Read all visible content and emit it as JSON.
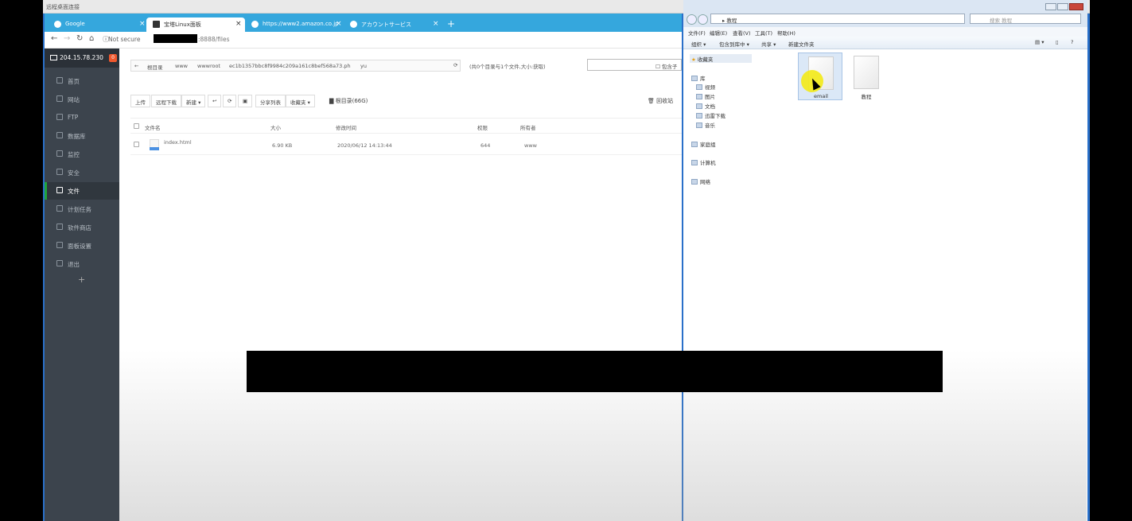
{
  "remote_window": {
    "title": "远程桌面连接"
  },
  "browser": {
    "tabs": [
      {
        "label": "Google",
        "icon": "google-icon"
      },
      {
        "label": "宝塔Linux面板",
        "icon": "bt-icon"
      },
      {
        "label": "https://www2.amazon.co.jp",
        "icon": "globe-icon"
      },
      {
        "label": "アカウントサービス",
        "icon": "amazon-icon"
      }
    ],
    "new_tab": "+",
    "address": {
      "security": "Not secure",
      "rest": ":8888/files"
    }
  },
  "panel": {
    "server_ip": "204.15.78.230",
    "badge": "0",
    "sidebar": [
      {
        "label": "首页"
      },
      {
        "label": "网站"
      },
      {
        "label": "FTP"
      },
      {
        "label": "数据库"
      },
      {
        "label": "监控"
      },
      {
        "label": "安全"
      },
      {
        "label": "文件"
      },
      {
        "label": "计划任务"
      },
      {
        "label": "软件商店"
      },
      {
        "label": "面板设置"
      },
      {
        "label": "退出"
      }
    ],
    "add": "+",
    "breadcrumb": [
      "根目录",
      "www",
      "wwwroot",
      "ec1b1357bbc8f9984c209a161c8bef568a73.ph",
      "yu"
    ],
    "path_info": "(共0个目录与1个文件,大小:获取)",
    "search_checkbox": "包含子",
    "toolbar": [
      "上传",
      "远程下载",
      "新建 ▾",
      "↩",
      "⟳",
      "▣",
      "分享列表",
      "收藏夹 ▾"
    ],
    "root_dir": "根目录(66G)",
    "recycle": "回收站",
    "columns": [
      "文件名",
      "大小",
      "修改时间",
      "权限",
      "所有者"
    ],
    "files": [
      {
        "name": "index.html",
        "size": "6.90 KB",
        "mtime": "2020/06/12 14:13:44",
        "perm": "644",
        "owner": "www"
      }
    ]
  },
  "explorer": {
    "address": "教程",
    "search_placeholder": "搜索 教程",
    "menu": [
      "文件(F)",
      "编辑(E)",
      "查看(V)",
      "工具(T)",
      "帮助(H)"
    ],
    "toolbar": [
      "组织 ▾",
      "包含到库中 ▾",
      "共享 ▾",
      "新建文件夹"
    ],
    "nav": {
      "favorites": "收藏夹",
      "libraries": "库",
      "library_items": [
        "视频",
        "图片",
        "文档",
        "迅雷下载",
        "音乐"
      ],
      "homegroup": "家庭组",
      "computer": "计算机",
      "network": "网络"
    },
    "items": [
      {
        "label": "email"
      },
      {
        "label": "教程"
      }
    ]
  }
}
